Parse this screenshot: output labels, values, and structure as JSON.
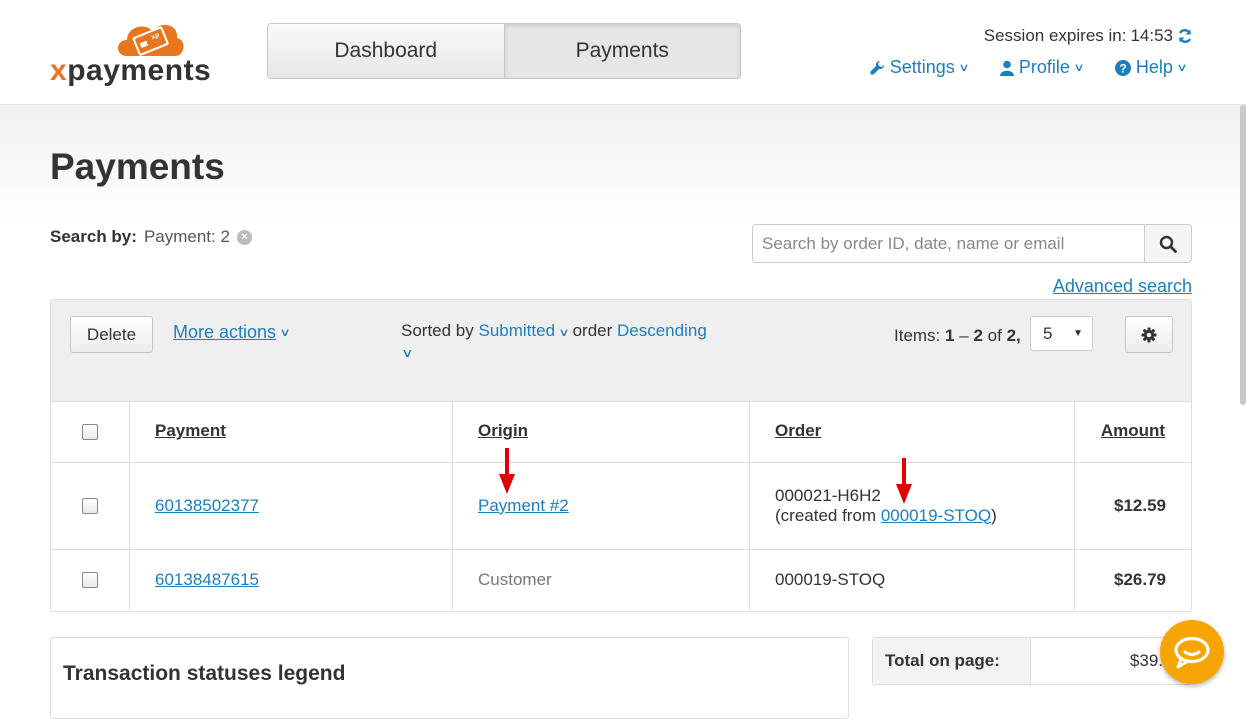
{
  "logo": {
    "text_x": "x",
    "text_rest": "payments",
    "badge": "xp"
  },
  "nav": {
    "tabs": [
      {
        "label": "Dashboard"
      },
      {
        "label": "Payments"
      }
    ]
  },
  "session": {
    "label": "Session expires in:",
    "time": "14:53"
  },
  "topmenu": {
    "settings": "Settings",
    "profile": "Profile",
    "help": "Help"
  },
  "page": {
    "title": "Payments"
  },
  "search_by": {
    "label": "Search by:",
    "value": "Payment: 2"
  },
  "search": {
    "placeholder": "Search by order ID, date, name or email"
  },
  "advanced_search": "Advanced search",
  "toolbar": {
    "delete_label": "Delete",
    "more_actions": "More actions",
    "sorted_by_label": "Sorted by",
    "sorted_by_value": "Submitted",
    "order_label": "order",
    "order_value": "Descending",
    "items_label": "Items:",
    "items_from": "1",
    "items_dash": "–",
    "items_to": "2",
    "items_of": "of",
    "items_total": "2,",
    "per_page": "5"
  },
  "table": {
    "headers": {
      "payment": "Payment",
      "origin": "Origin",
      "order": "Order",
      "amount": "Amount"
    },
    "rows": [
      {
        "payment": "60138502377",
        "origin": "Payment #2",
        "order_id": "000021-H6H2",
        "order_created_prefix": "(created from ",
        "order_created_link": "000019-STOQ",
        "order_created_suffix": ")",
        "amount": "$12.59"
      },
      {
        "payment": "60138487615",
        "origin": "Customer",
        "order_id": "000019-STOQ",
        "amount": "$26.79"
      }
    ]
  },
  "legend": {
    "title": "Transaction statuses legend"
  },
  "totals": {
    "label": "Total on page:",
    "value": "$39."
  },
  "colors": {
    "link": "#1a7fc1",
    "brand_orange": "#e8761e",
    "chat": "#f7a500",
    "arrow": "#e00000"
  }
}
